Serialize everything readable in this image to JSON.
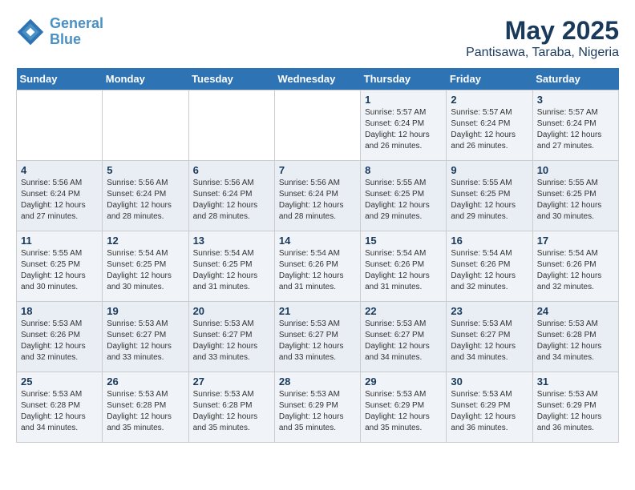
{
  "logo": {
    "line1": "General",
    "line2": "Blue"
  },
  "title": "May 2025",
  "location": "Pantisawa, Taraba, Nigeria",
  "days_of_week": [
    "Sunday",
    "Monday",
    "Tuesday",
    "Wednesday",
    "Thursday",
    "Friday",
    "Saturday"
  ],
  "weeks": [
    [
      {
        "day": "",
        "info": ""
      },
      {
        "day": "",
        "info": ""
      },
      {
        "day": "",
        "info": ""
      },
      {
        "day": "",
        "info": ""
      },
      {
        "day": "1",
        "info": "Sunrise: 5:57 AM\nSunset: 6:24 PM\nDaylight: 12 hours\nand 26 minutes."
      },
      {
        "day": "2",
        "info": "Sunrise: 5:57 AM\nSunset: 6:24 PM\nDaylight: 12 hours\nand 26 minutes."
      },
      {
        "day": "3",
        "info": "Sunrise: 5:57 AM\nSunset: 6:24 PM\nDaylight: 12 hours\nand 27 minutes."
      }
    ],
    [
      {
        "day": "4",
        "info": "Sunrise: 5:56 AM\nSunset: 6:24 PM\nDaylight: 12 hours\nand 27 minutes."
      },
      {
        "day": "5",
        "info": "Sunrise: 5:56 AM\nSunset: 6:24 PM\nDaylight: 12 hours\nand 28 minutes."
      },
      {
        "day": "6",
        "info": "Sunrise: 5:56 AM\nSunset: 6:24 PM\nDaylight: 12 hours\nand 28 minutes."
      },
      {
        "day": "7",
        "info": "Sunrise: 5:56 AM\nSunset: 6:24 PM\nDaylight: 12 hours\nand 28 minutes."
      },
      {
        "day": "8",
        "info": "Sunrise: 5:55 AM\nSunset: 6:25 PM\nDaylight: 12 hours\nand 29 minutes."
      },
      {
        "day": "9",
        "info": "Sunrise: 5:55 AM\nSunset: 6:25 PM\nDaylight: 12 hours\nand 29 minutes."
      },
      {
        "day": "10",
        "info": "Sunrise: 5:55 AM\nSunset: 6:25 PM\nDaylight: 12 hours\nand 30 minutes."
      }
    ],
    [
      {
        "day": "11",
        "info": "Sunrise: 5:55 AM\nSunset: 6:25 PM\nDaylight: 12 hours\nand 30 minutes."
      },
      {
        "day": "12",
        "info": "Sunrise: 5:54 AM\nSunset: 6:25 PM\nDaylight: 12 hours\nand 30 minutes."
      },
      {
        "day": "13",
        "info": "Sunrise: 5:54 AM\nSunset: 6:25 PM\nDaylight: 12 hours\nand 31 minutes."
      },
      {
        "day": "14",
        "info": "Sunrise: 5:54 AM\nSunset: 6:26 PM\nDaylight: 12 hours\nand 31 minutes."
      },
      {
        "day": "15",
        "info": "Sunrise: 5:54 AM\nSunset: 6:26 PM\nDaylight: 12 hours\nand 31 minutes."
      },
      {
        "day": "16",
        "info": "Sunrise: 5:54 AM\nSunset: 6:26 PM\nDaylight: 12 hours\nand 32 minutes."
      },
      {
        "day": "17",
        "info": "Sunrise: 5:54 AM\nSunset: 6:26 PM\nDaylight: 12 hours\nand 32 minutes."
      }
    ],
    [
      {
        "day": "18",
        "info": "Sunrise: 5:53 AM\nSunset: 6:26 PM\nDaylight: 12 hours\nand 32 minutes."
      },
      {
        "day": "19",
        "info": "Sunrise: 5:53 AM\nSunset: 6:27 PM\nDaylight: 12 hours\nand 33 minutes."
      },
      {
        "day": "20",
        "info": "Sunrise: 5:53 AM\nSunset: 6:27 PM\nDaylight: 12 hours\nand 33 minutes."
      },
      {
        "day": "21",
        "info": "Sunrise: 5:53 AM\nSunset: 6:27 PM\nDaylight: 12 hours\nand 33 minutes."
      },
      {
        "day": "22",
        "info": "Sunrise: 5:53 AM\nSunset: 6:27 PM\nDaylight: 12 hours\nand 34 minutes."
      },
      {
        "day": "23",
        "info": "Sunrise: 5:53 AM\nSunset: 6:27 PM\nDaylight: 12 hours\nand 34 minutes."
      },
      {
        "day": "24",
        "info": "Sunrise: 5:53 AM\nSunset: 6:28 PM\nDaylight: 12 hours\nand 34 minutes."
      }
    ],
    [
      {
        "day": "25",
        "info": "Sunrise: 5:53 AM\nSunset: 6:28 PM\nDaylight: 12 hours\nand 34 minutes."
      },
      {
        "day": "26",
        "info": "Sunrise: 5:53 AM\nSunset: 6:28 PM\nDaylight: 12 hours\nand 35 minutes."
      },
      {
        "day": "27",
        "info": "Sunrise: 5:53 AM\nSunset: 6:28 PM\nDaylight: 12 hours\nand 35 minutes."
      },
      {
        "day": "28",
        "info": "Sunrise: 5:53 AM\nSunset: 6:29 PM\nDaylight: 12 hours\nand 35 minutes."
      },
      {
        "day": "29",
        "info": "Sunrise: 5:53 AM\nSunset: 6:29 PM\nDaylight: 12 hours\nand 35 minutes."
      },
      {
        "day": "30",
        "info": "Sunrise: 5:53 AM\nSunset: 6:29 PM\nDaylight: 12 hours\nand 36 minutes."
      },
      {
        "day": "31",
        "info": "Sunrise: 5:53 AM\nSunset: 6:29 PM\nDaylight: 12 hours\nand 36 minutes."
      }
    ]
  ]
}
